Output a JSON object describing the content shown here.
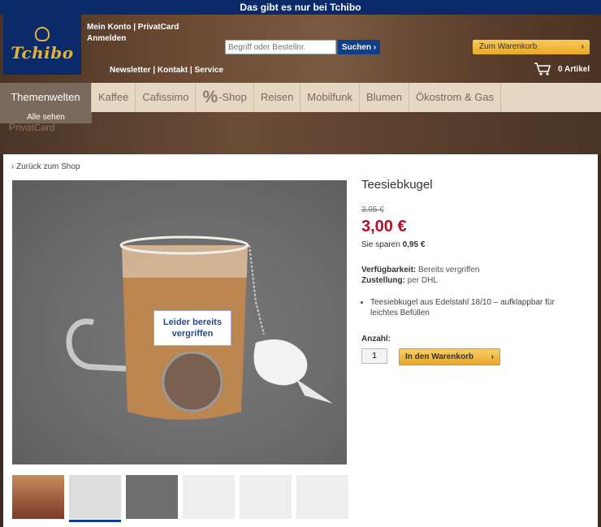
{
  "banner": {
    "text": "Das gibt es nur bei Tchibo"
  },
  "logo": {
    "text": "Tchibo"
  },
  "account": {
    "line1": "Mein Konto | PrivatCard",
    "line2": "Anmelden"
  },
  "search": {
    "placeholder": "Begriff oder Bestellnr.",
    "button": "Suchen ›"
  },
  "cart": {
    "button": "Zum Warenkorb",
    "count": "0 Artikel"
  },
  "utility": {
    "links": "Newsletter | Kontakt | Service"
  },
  "nav": {
    "items": [
      "Themenwelten",
      "Kaffee",
      "Cafissimo",
      "-Shop",
      "Reisen",
      "Mobilfunk",
      "Blumen",
      "Ökostrom & Gas"
    ],
    "shop_prefix": "%",
    "sub_active": "Alle sehen",
    "ghost": "PrivatCard"
  },
  "product": {
    "back": "› Zurück zum Shop",
    "title": "Teesiebkugel",
    "old_price": "3,95 €",
    "price": "3,00 €",
    "save_label": "Sie sparen",
    "save_value": "0,95 €",
    "avail_label": "Verfügbarkeit:",
    "avail_value": "Bereits vergriffen",
    "delivery_label": "Zustellung:",
    "delivery_value": "per DHL",
    "bullet": "Teesiebkugel aus Edelstahl 18/10 – aufklappbar für leichtes Befüllen",
    "qty_label": "Anzahl:",
    "qty_value": "1",
    "add_cart": "In den Warenkorb",
    "sold_badge": "Leider bereits vergriffen"
  },
  "colors": {
    "brand_blue": "#0a2a6a",
    "price_red": "#b0102a",
    "button_gold": "#e8a928"
  }
}
